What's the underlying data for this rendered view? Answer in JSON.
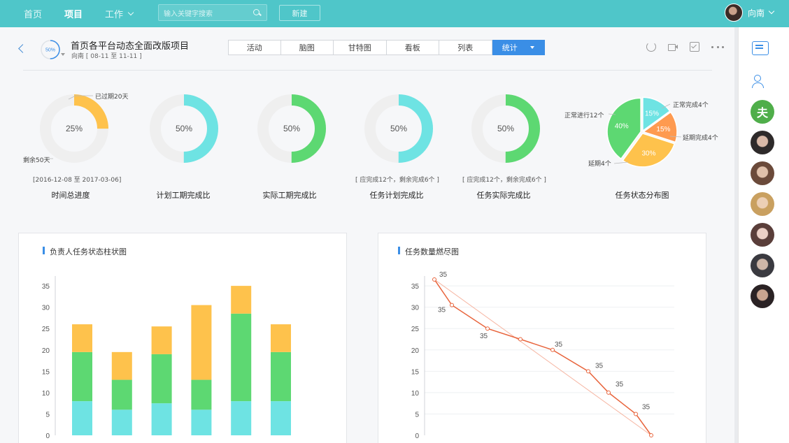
{
  "nav": {
    "items": [
      {
        "label": "首页",
        "active": false
      },
      {
        "label": "项目",
        "active": true
      },
      {
        "label": "工作",
        "active": false,
        "has_dropdown": true
      }
    ],
    "search_placeholder": "输入关键字搜索",
    "new_button": "新建",
    "user_name": "向南"
  },
  "project": {
    "progress": "50%",
    "progress_value": 50,
    "title": "首页各平台动态全面改版项目",
    "owner": "向南",
    "date_range": "[ 08-11 至 11-11 ]"
  },
  "tabs": [
    {
      "label": "活动",
      "active": false
    },
    {
      "label": "脑图",
      "active": false
    },
    {
      "label": "甘特图",
      "active": false
    },
    {
      "label": "看板",
      "active": false
    },
    {
      "label": "列表",
      "active": false
    },
    {
      "label": "统计",
      "active": true
    }
  ],
  "donuts": [
    {
      "label": "时间总进度",
      "percent": 25,
      "center": "25%",
      "color": "#fec24c",
      "note": "[2016-12-08 至 2017-03-06]",
      "callout_top": "已过期20天",
      "callout_bottom": "剩余50天"
    },
    {
      "label": "计划工期完成比",
      "percent": 50,
      "center": "50%",
      "color": "#6ee3e3",
      "note": ""
    },
    {
      "label": "实际工期完成比",
      "percent": 50,
      "center": "50%",
      "color": "#5dd872",
      "note": ""
    },
    {
      "label": "任务计划完成比",
      "percent": 50,
      "center": "50%",
      "color": "#6ee3e3",
      "note": "[ 应完成12个，剩余完成6个 ]"
    },
    {
      "label": "任务实际完成比",
      "percent": 50,
      "center": "50%",
      "color": "#5dd872",
      "note": "[ 应完成12个，剩余完成6个 ]"
    }
  ],
  "pie": {
    "label": "任务状态分布图",
    "slices": [
      {
        "name": "正常完成4个",
        "value": 15,
        "text": "15%",
        "color": "#6ee3e3"
      },
      {
        "name": "延期完成4个",
        "value": 15,
        "text": "15%",
        "color": "#fe9a50"
      },
      {
        "name": "延期4个",
        "value": 30,
        "text": "30%",
        "color": "#fec24c"
      },
      {
        "name": "正常进行12个",
        "value": 40,
        "text": "40%",
        "color": "#5dd872"
      }
    ]
  },
  "bar_card": {
    "title": "负责人任务状态柱状图"
  },
  "burn_card": {
    "title": "任务数量燃尽图"
  },
  "chart_data": [
    {
      "type": "bar",
      "stacked": true,
      "categories": [
        "",
        "",
        "",
        "",
        "",
        ""
      ],
      "series": [
        {
          "values": [
            8,
            6,
            7.5,
            6,
            8,
            8
          ],
          "color": "#6ee3e3"
        },
        {
          "values": [
            11.5,
            7,
            11.5,
            7,
            20.5,
            11.5
          ],
          "color": "#5dd872"
        },
        {
          "values": [
            6.5,
            6.5,
            6.5,
            17.5,
            6.5,
            6.5
          ],
          "color": "#fec24c"
        }
      ],
      "yticks": [
        0,
        5,
        10,
        15,
        20,
        25,
        30,
        35
      ],
      "ylim": [
        0,
        36
      ]
    },
    {
      "type": "line",
      "x": [
        0,
        1,
        2,
        3,
        4,
        5,
        6,
        7,
        8
      ],
      "series": [
        {
          "values": [
            36.5,
            30.5,
            25,
            22.5,
            20,
            15,
            10,
            5,
            0
          ],
          "color": "#e8643c"
        }
      ],
      "ideal": [
        36.5,
        0
      ],
      "point_labels": [
        "35",
        "35",
        "35",
        "",
        "35",
        "35",
        "35",
        "35",
        ""
      ],
      "yticks": [
        0,
        5,
        10,
        15,
        20,
        25,
        30,
        35
      ],
      "ylim": [
        0,
        36
      ]
    }
  ]
}
